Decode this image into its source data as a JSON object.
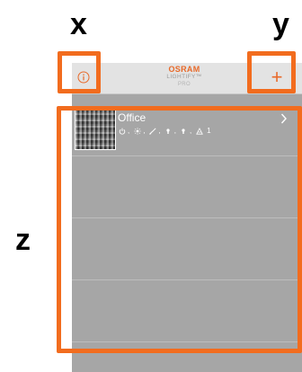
{
  "callouts": {
    "x": "x",
    "y": "y",
    "z": "z"
  },
  "header": {
    "brand": "OSRAM",
    "product": "LIGHTIFY™",
    "edition": "PRO",
    "info_icon": "info-circle-icon",
    "add_label": "+"
  },
  "rooms": [
    {
      "name": "Office",
      "status": {
        "icons": [
          "power-icon",
          "brightness-icon",
          "color-brush-icon",
          "bulb-icon",
          "bulb-icon",
          "sensor-icon"
        ],
        "count": "1",
        "separator": ","
      }
    }
  ],
  "colors": {
    "accent": "#e86a2a",
    "annotation": "#f26c1e",
    "list_background": "#a6a6a6",
    "header_background": "#e3e3e3"
  }
}
